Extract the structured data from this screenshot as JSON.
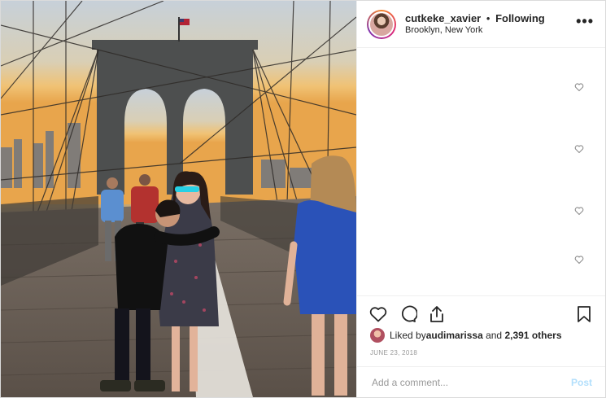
{
  "post": {
    "username": "cutkeke_xavier",
    "separator": "•",
    "follow_status": "Following",
    "location": "Brooklyn, New York",
    "more_label": "•••",
    "likes_prefix": "Liked by ",
    "liked_by_user": "audimarissa",
    "likes_mid": " and ",
    "likes_count": "2,391 others",
    "date": "JUNE 23, 2018",
    "comment_placeholder": "Add a comment...",
    "post_label": "Post"
  },
  "icons": {
    "like": "heart-icon",
    "comment": "comment-icon",
    "share": "share-icon",
    "save": "bookmark-icon",
    "comment_like": "heart-icon",
    "more": "more-options-icon"
  },
  "colors": {
    "text": "#262626",
    "muted": "#999999",
    "border": "#dbdbdb",
    "post_button": "#b2dffc",
    "avatar_ring": "#dd2a7b"
  },
  "photo": {
    "alt_description": ""
  }
}
